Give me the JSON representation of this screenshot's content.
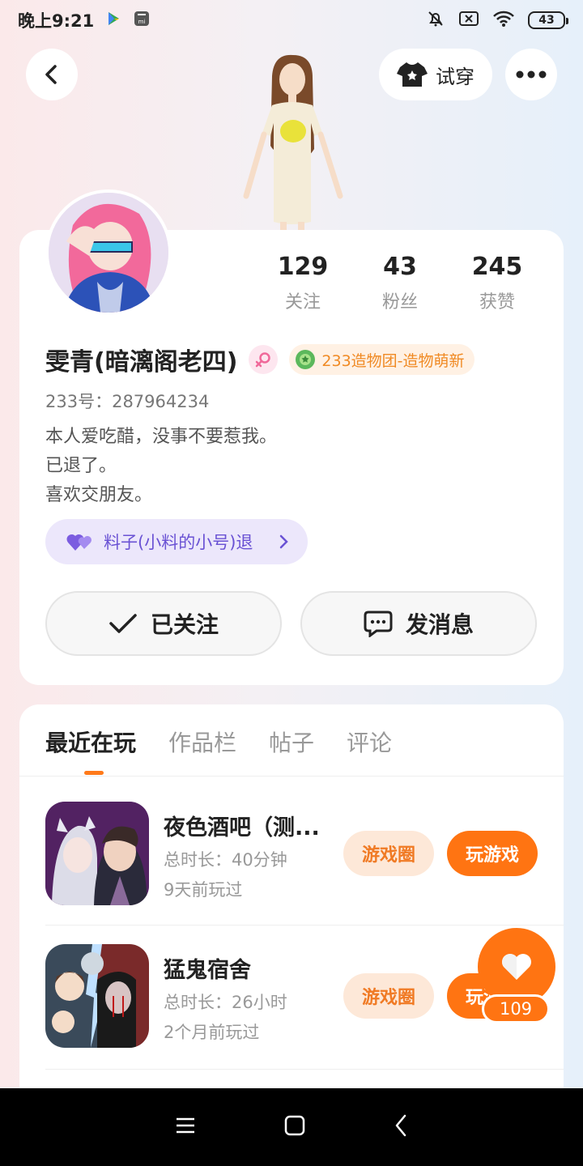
{
  "status_bar": {
    "time": "晚上9:21",
    "battery": "43"
  },
  "header": {
    "try_on_label": "试穿"
  },
  "profile": {
    "stats": [
      {
        "value": "129",
        "label": "关注"
      },
      {
        "value": "43",
        "label": "粉丝"
      },
      {
        "value": "245",
        "label": "获赞"
      }
    ],
    "name": "雯青(暗漓阁老四)",
    "group_badge": "233造物团-造物萌新",
    "id_line": "233号：287964234",
    "bio_lines": [
      "本人爱吃醋，没事不要惹我。",
      "已退了。",
      "喜欢交朋友。"
    ],
    "partner_tag": "料子(小料的小号)退",
    "follow_button": "已关注",
    "message_button": "发消息"
  },
  "tabs": [
    "最近在玩",
    "作品栏",
    "帖子",
    "评论"
  ],
  "games": [
    {
      "title": "夜色酒吧（测...",
      "duration": "总时长：40分钟",
      "last_played": "9天前玩过",
      "circle_label": "游戏圈",
      "play_label": "玩游戏"
    },
    {
      "title": "猛鬼宿舍",
      "duration": "总时长：26小时",
      "last_played": "2个月前玩过",
      "circle_label": "游戏圈",
      "play_label": "玩游戏"
    }
  ],
  "like_count": "109",
  "colors": {
    "accent": "#ff7412",
    "partner": "#6a52d4",
    "badge": "#f08a24"
  }
}
